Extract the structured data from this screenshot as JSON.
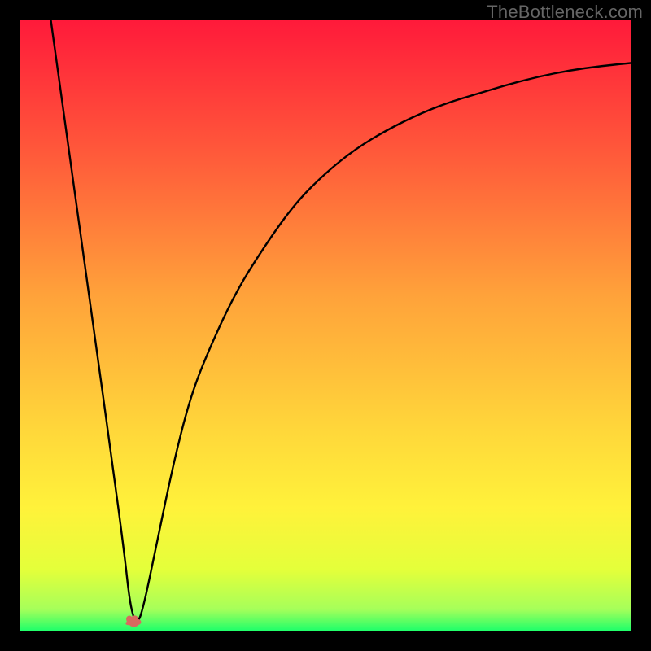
{
  "watermark": "TheBottleneck.com",
  "chart_data": {
    "type": "line",
    "title": "",
    "xlabel": "",
    "ylabel": "",
    "xlim": [
      0,
      100
    ],
    "ylim": [
      0,
      100
    ],
    "legend": false,
    "grid": false,
    "series": [
      {
        "name": "bottleneck-curve",
        "x": [
          5,
          7.5,
          10,
          12.5,
          15,
          17,
          18,
          19,
          20,
          22.5,
          25,
          27.5,
          30,
          35,
          40,
          45,
          50,
          55,
          60,
          65,
          70,
          75,
          80,
          85,
          90,
          95,
          100
        ],
        "values": [
          100,
          82,
          64,
          46,
          28,
          13,
          4,
          1,
          3,
          15,
          27,
          37,
          44,
          55,
          63,
          70,
          75,
          79,
          82,
          84.5,
          86.5,
          88,
          89.5,
          90.8,
          91.8,
          92.5,
          93
        ]
      }
    ],
    "background_gradient": {
      "top_color": "#ff1a3a",
      "stops": [
        {
          "offset": 0.0,
          "color": "#ff1a3a"
        },
        {
          "offset": 0.22,
          "color": "#ff5a3a"
        },
        {
          "offset": 0.45,
          "color": "#ffa23a"
        },
        {
          "offset": 0.68,
          "color": "#ffd93a"
        },
        {
          "offset": 0.8,
          "color": "#fff23a"
        },
        {
          "offset": 0.9,
          "color": "#e4ff3a"
        },
        {
          "offset": 0.965,
          "color": "#a6ff5a"
        },
        {
          "offset": 1.0,
          "color": "#1fff6a"
        }
      ]
    },
    "marker": {
      "x": 18.5,
      "y": 1.5,
      "color": "#d86a5f",
      "name": "optimum-marker"
    },
    "axes_visible": false
  }
}
